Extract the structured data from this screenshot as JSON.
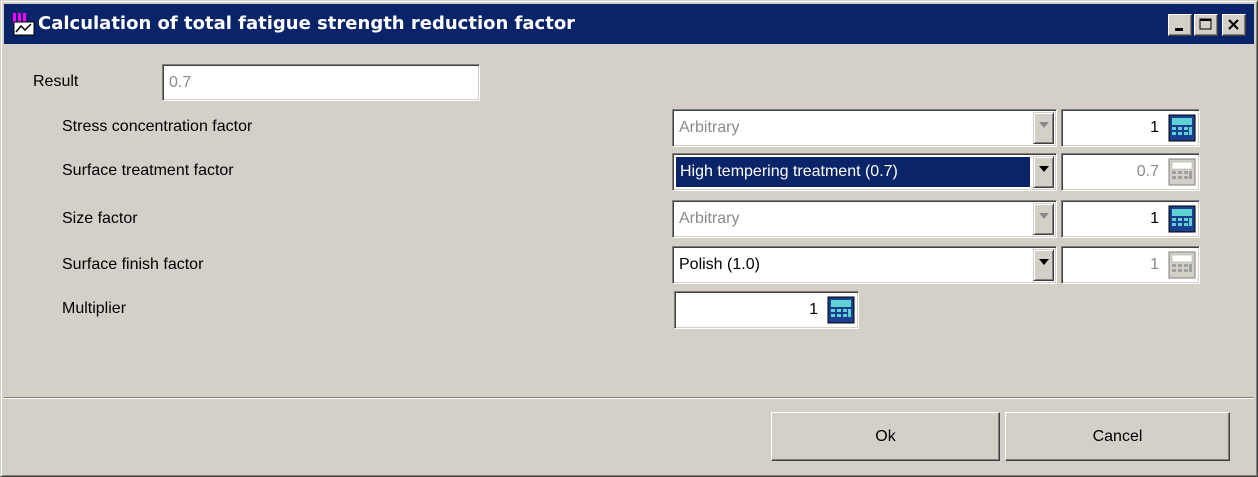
{
  "window": {
    "title": "Calculation of total fatigue strength reduction factor",
    "controls": {
      "minimize": "minimize",
      "maximize": "maximize",
      "close": "close"
    }
  },
  "result": {
    "label": "Result",
    "value": "0.7"
  },
  "factors": [
    {
      "label": "Stress concentration factor",
      "combo_value": "Arbitrary",
      "combo_enabled": false,
      "value": "1",
      "value_enabled": true
    },
    {
      "label": "Surface treatment factor",
      "combo_value": "High tempering treatment (0.7)",
      "combo_enabled": true,
      "combo_selected": true,
      "value": "0.7",
      "value_enabled": false
    },
    {
      "label": "Size factor",
      "combo_value": "Arbitrary",
      "combo_enabled": false,
      "value": "1",
      "value_enabled": true
    },
    {
      "label": "Surface finish factor",
      "combo_value": "Polish (1.0)",
      "combo_enabled": true,
      "value": "1",
      "value_enabled": false
    }
  ],
  "multiplier": {
    "label": "Multiplier",
    "value": "1"
  },
  "buttons": {
    "ok": "Ok",
    "cancel": "Cancel"
  },
  "icons": {
    "app": "app-icon",
    "calculator": "calculator-icon",
    "dropdown": "dropdown-arrow-icon"
  },
  "colors": {
    "titlebar": "#0a246a",
    "selection": "#0a246a",
    "face": "#d4d0c8"
  }
}
